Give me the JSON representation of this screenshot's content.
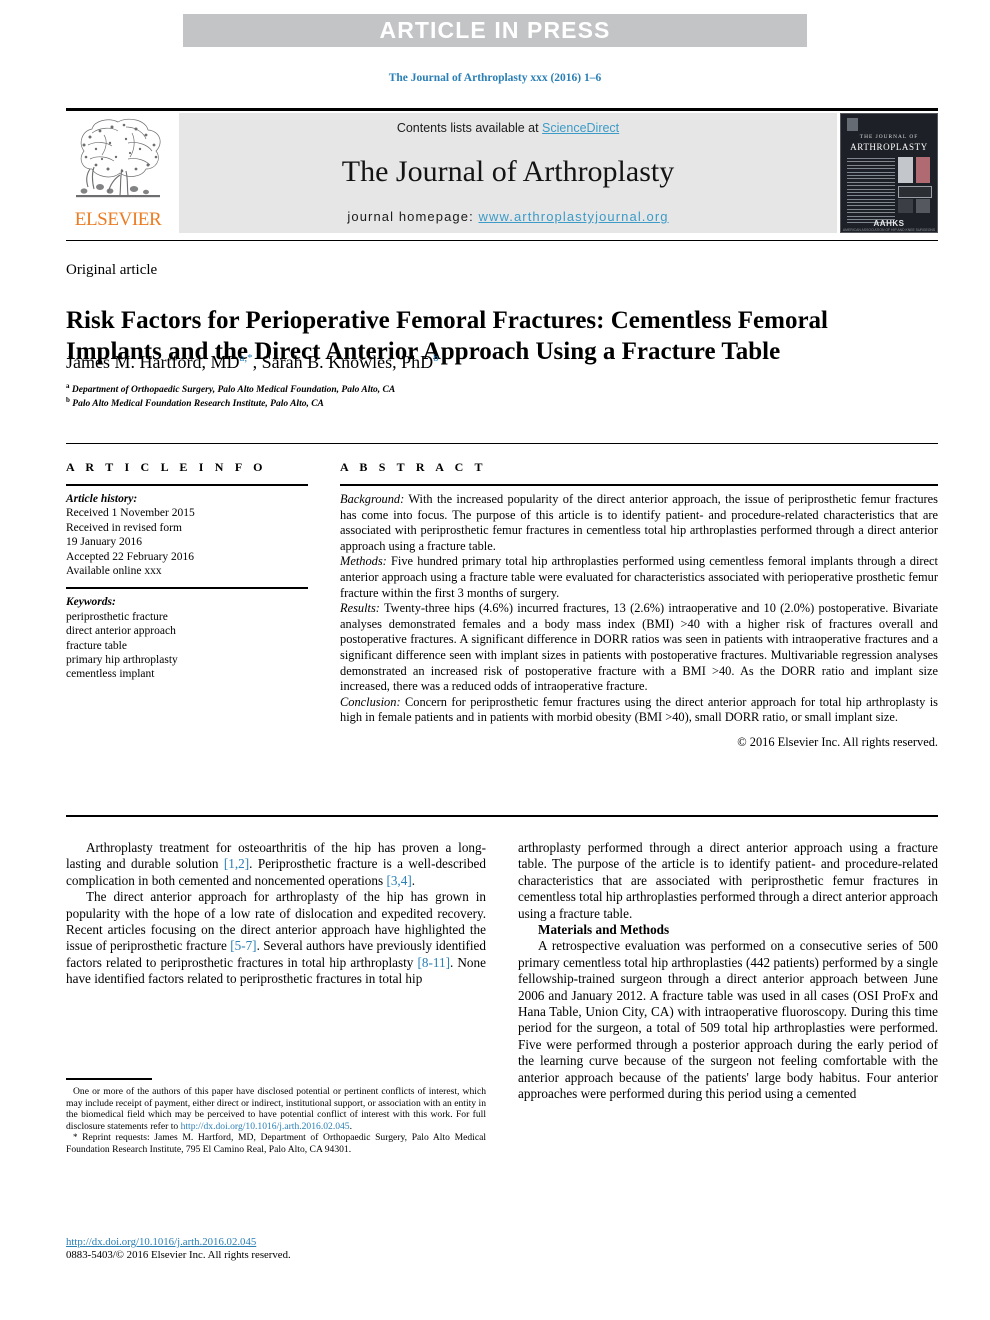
{
  "banner": {
    "text": "ARTICLE IN PRESS"
  },
  "citation": {
    "text": "The Journal of Arthroplasty xxx (2016) 1–6"
  },
  "masthead": {
    "contents_prefix": "Contents lists available at ",
    "sciencedirect": "ScienceDirect",
    "journal_name": "The Journal of Arthroplasty",
    "homepage_prefix": "journal homepage: ",
    "homepage_url": "www.arthroplastyjournal.org",
    "publisher_logo_text": "ELSEVIER",
    "cover": {
      "subtitle": "THE JOURNAL OF",
      "title": "ARTHROPLASTY",
      "society": "AAHKS",
      "society_sub": "AMERICAN ASSOCIATION OF HIP AND KNEE SURGEONS"
    }
  },
  "article": {
    "type_label": "Original article",
    "title": "Risk Factors for Perioperative Femoral Fractures: Cementless Femoral Implants and the Direct Anterior Approach Using a Fracture Table",
    "authors_1": "James M. Hartford, MD",
    "authors_1_sup_a": "a",
    "authors_1_sup_star": ",*",
    "authors_2": ", Sarah B. Knowles, PhD",
    "authors_2_sup": "b",
    "affiliation_a_marker": "a",
    "affiliation_a": " Department of Orthopaedic Surgery, Palo Alto Medical Foundation, Palo Alto, CA",
    "affiliation_b_marker": "b",
    "affiliation_b": " Palo Alto Medical Foundation Research Institute, Palo Alto, CA"
  },
  "info": {
    "heading": "A R T I C L E   I N F O",
    "history_label": "Article history:",
    "history_lines": "Received 1 November 2015\nReceived in revised form\n19 January 2016\nAccepted 22 February 2016\nAvailable online xxx",
    "keywords_label": "Keywords:",
    "keywords_lines": "periprosthetic fracture\ndirect anterior approach\nfracture table\nprimary hip arthroplasty\ncementless implant"
  },
  "abstract": {
    "heading": "A B S T R A C T",
    "background_label": "Background:",
    "background_text": " With the increased popularity of the direct anterior approach, the issue of periprosthetic femur fractures has come into focus. The purpose of this article is to identify patient- and procedure-related characteristics that are associated with periprosthetic femur fractures in cementless total hip arthroplasties performed through a direct anterior approach using a fracture table.",
    "methods_label": "Methods:",
    "methods_text": " Five hundred primary total hip arthroplasties performed using cementless femoral implants through a direct anterior approach using a fracture table were evaluated for characteristics associated with perioperative prosthetic femur fracture within the first 3 months of surgery.",
    "results_label": "Results:",
    "results_text": " Twenty-three hips (4.6%) incurred fractures, 13 (2.6%) intraoperative and 10 (2.0%) postoperative. Bivariate analyses demonstrated females and a body mass index (BMI) >40 with a higher risk of fractures overall and postoperative fractures. A significant difference in DORR ratios was seen in patients with intraoperative fractures and a significant difference seen with implant sizes in patients with postoperative fractures. Multivariable regression analyses demonstrated an increased risk of postoperative fracture with a BMI >40. As the DORR ratio and implant size increased, there was a reduced odds of intraoperative fracture.",
    "conclusion_label": "Conclusion:",
    "conclusion_text": " Concern for periprosthetic femur fractures using the direct anterior approach for total hip arthroplasty is high in female patients and in patients with morbid obesity (BMI >40), small DORR ratio, or small implant size.",
    "copyright": "© 2016 Elsevier Inc. All rights reserved."
  },
  "body": {
    "left_p1_a": "Arthroplasty treatment for osteoarthritis of the hip has proven a long-lasting and durable solution ",
    "left_p1_ref1": "[1,2]",
    "left_p1_b": ". Periprosthetic fracture is a well-described complication in both cemented and noncemented operations ",
    "left_p1_ref2": "[3,4]",
    "left_p1_c": ".",
    "left_p2_a": "The direct anterior approach for arthroplasty of the hip has grown in popularity with the hope of a low rate of dislocation and expedited recovery. Recent articles focusing on the direct anterior approach have highlighted the issue of periprosthetic fracture ",
    "left_p2_ref1": "[5-7]",
    "left_p2_b": ". Several authors have previously identified factors related to periprosthetic fractures in total hip arthroplasty ",
    "left_p2_ref2": "[8-11]",
    "left_p2_c": ". None have identified factors related to periprosthetic fractures in total hip",
    "right_p1": "arthroplasty performed through a direct anterior approach using a fracture table. The purpose of the article is to identify patient- and procedure-related characteristics that are associated with periprosthetic femur fractures in cementless total hip arthroplasties performed through a direct anterior approach using a fracture table.",
    "right_section_heading": "Materials and Methods",
    "right_p2": "A retrospective evaluation was performed on a consecutive series of 500 primary cementless total hip arthroplasties (442 patients) performed by a single fellowship-trained surgeon through a direct anterior approach between June 2006 and January 2012. A fracture table was used in all cases (OSI ProFx and Hana Table, Union City, CA) with intraoperative fluoroscopy. During this time period for the surgeon, a total of 509 total hip arthroplasties were performed. Five were performed through a posterior approach during the early period of the learning curve because of the surgeon not feeling comfortable with the anterior approach because of the patients' large body habitus. Four anterior approaches were performed during this period using a cemented"
  },
  "footnotes": {
    "disclosure_a": "One or more of the authors of this paper have disclosed potential or pertinent conflicts of interest, which may include receipt of payment, either direct or indirect, institutional support, or association with an entity in the biomedical field which may be perceived to have potential conflict of interest with this work. For full disclosure statements refer to ",
    "disclosure_link": "http://dx.doi.org/10.1016/j.arth.2016.02.045",
    "disclosure_end": ".",
    "reprint_star": "*",
    "reprint": " Reprint requests: James M. Hartford, MD, Department of Orthopaedic Surgery, Palo Alto Medical Foundation Research Institute, 795 El Camino Real, Palo Alto, CA 94301."
  },
  "doi_block": {
    "doi_url": "http://dx.doi.org/10.1016/j.arth.2016.02.045",
    "issn_line": "0883-5403/© 2016 Elsevier Inc. All rights reserved."
  },
  "colors": {
    "link": "#2a7fb5",
    "sciencedirect": "#3d9bc7",
    "elsevier_orange": "#eb7c22",
    "banner_gray": "#c3c4c6",
    "masthead_gray": "#e6e6e6"
  }
}
